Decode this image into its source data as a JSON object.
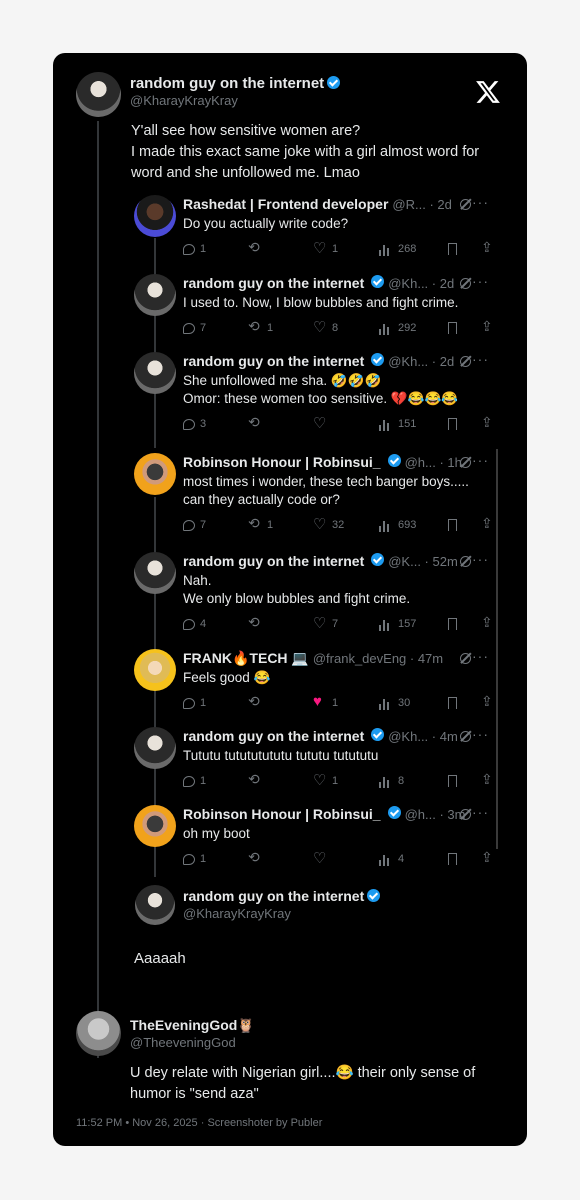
{
  "main_post": {
    "name": "random guy on the internet",
    "handle": "@KharayKrayKray",
    "text_lines": [
      "Y'all see how sensitive women are?",
      "I made this exact same joke with a girl almost word for",
      "word and she unfollowed me. Lmao"
    ]
  },
  "replies": [
    {
      "name": "Rashedat | Frontend developer",
      "verified": false,
      "handle_meta": "@R... · 2d",
      "lines": [
        "Do you actually write code?"
      ],
      "reply": "1",
      "retweet": "",
      "like": "1",
      "views": "268",
      "avatar": "av-lady"
    },
    {
      "name": "random guy on the internet",
      "verified": true,
      "handle_meta": "@Kh... · 2d",
      "lines": [
        "I used to. Now, I blow bubbles and fight crime."
      ],
      "reply": "7",
      "retweet": "1",
      "like": "8",
      "views": "292",
      "avatar": "av-dark"
    },
    {
      "name": "random guy on the internet",
      "verified": true,
      "handle_meta": "@Kh... · 2d",
      "lines": [
        "She unfollowed me sha. 🤣🤣🤣",
        "Omor: these women too sensitive. 💔😂😂😂"
      ],
      "reply": "3",
      "retweet": "",
      "like": "",
      "views": "151",
      "avatar": "av-dark"
    },
    {
      "name": "Robinson Honour | Robinsui_",
      "verified": true,
      "handle_meta": "@h... · 1h",
      "lines": [
        "most times i wonder, these tech banger boys.....",
        "can they actually code or?"
      ],
      "reply": "7",
      "retweet": "1",
      "like": "32",
      "views": "693",
      "avatar": "av-orange"
    },
    {
      "name": "random guy on the internet",
      "verified": true,
      "handle_meta": "@K... · 52m",
      "lines": [
        "Nah.",
        "We only blow bubbles and fight crime."
      ],
      "reply": "4",
      "retweet": "",
      "like": "7",
      "views": "157",
      "avatar": "av-dark"
    },
    {
      "name": "FRANK🔥TECH 💻",
      "verified": false,
      "handle_meta": "@frank_devEng · 47m",
      "lines": [
        "Feels good 😂"
      ],
      "reply": "1",
      "retweet": "",
      "like": "1",
      "views": "30",
      "avatar": "av-yellow",
      "liked": true
    },
    {
      "name": "random guy on the internet",
      "verified": true,
      "handle_meta": "@Kh... · 4m",
      "lines": [
        "Tututu tutututututu tututu tutututu"
      ],
      "reply": "1",
      "retweet": "",
      "like": "1",
      "views": "8",
      "avatar": "av-dark"
    },
    {
      "name": "Robinson Honour | Robinsui_",
      "verified": true,
      "handle_meta": "@h... · 3m",
      "lines": [
        "oh my boot"
      ],
      "reply": "1",
      "retweet": "",
      "like": "",
      "views": "4",
      "avatar": "av-orange"
    }
  ],
  "quoted": {
    "name": "random guy on the internet",
    "handle": "@KharayKrayKray",
    "text": "Aaaaah"
  },
  "comment": {
    "name": "TheEveningGod🦉",
    "handle": "@TheeveningGod",
    "text_lines": [
      "U dey relate with Nigerian girl....😂 their only sense of",
      "humor is \"send aza\""
    ]
  },
  "footer": "11:52 PM • Nov 26, 2025 · Screenshoter by Publer",
  "colors": {
    "card": "#000000",
    "verified": "#1d9bf0",
    "like_active": "#f91880",
    "muted": "#71767b"
  },
  "icons": [
    "x-logo-icon",
    "verified-badge-icon",
    "grok-icon",
    "more-icon",
    "reply-icon",
    "retweet-icon",
    "like-icon",
    "views-icon",
    "bookmark-icon",
    "share-icon"
  ]
}
